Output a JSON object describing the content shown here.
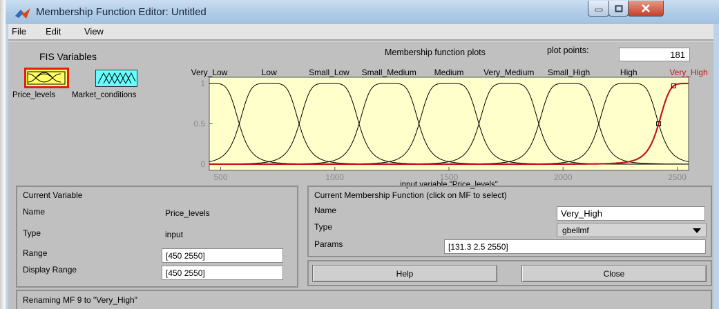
{
  "window": {
    "title": "Membership Function Editor: Untitled"
  },
  "menu": [
    "File",
    "Edit",
    "View"
  ],
  "fis": {
    "heading": "FIS Variables",
    "variables": [
      {
        "label": "Price_levels",
        "color": "#ffff66",
        "selected": true
      },
      {
        "label": "Market_conditions",
        "color": "#66ffff",
        "selected": false
      }
    ]
  },
  "plot": {
    "heading": "Membership function plots",
    "points_label": "plot points:",
    "points_value": "181",
    "xlabel": "input variable \"Price_levels\""
  },
  "chart_data": {
    "type": "line",
    "xlim": [
      450,
      2550
    ],
    "ylim": [
      0,
      1
    ],
    "xticks": [
      500,
      1000,
      1500,
      2000,
      2500
    ],
    "yticks": [
      0,
      0.5,
      1
    ],
    "xlabel": "input variable \"Price_levels\"",
    "series": [
      {
        "name": "Very_Low",
        "centers": [
          450
        ]
      },
      {
        "name": "Low",
        "centers": [
          712.5
        ]
      },
      {
        "name": "Small_Low",
        "centers": [
          975
        ]
      },
      {
        "name": "Small_Medium",
        "centers": [
          1237.5
        ]
      },
      {
        "name": "Medium",
        "centers": [
          1500
        ]
      },
      {
        "name": "Very_Medium",
        "centers": [
          1762.5
        ]
      },
      {
        "name": "Small_High",
        "centers": [
          2025
        ]
      },
      {
        "name": "High",
        "centers": [
          2287.5
        ]
      },
      {
        "name": "Very_High",
        "centers": [
          2550
        ],
        "params": [
          131.3,
          2.5,
          2550
        ],
        "selected": true,
        "color": "#c4161c"
      }
    ]
  },
  "current_variable": {
    "heading": "Current Variable",
    "name_label": "Name",
    "name_value": "Price_levels",
    "type_label": "Type",
    "type_value": "input",
    "range_label": "Range",
    "range_value": "[450 2550]",
    "display_range_label": "Display Range",
    "display_range_value": "[450 2550]"
  },
  "current_mf": {
    "heading": "Current Membership Function (click on MF to select)",
    "name_label": "Name",
    "name_value": "Very_High",
    "type_label": "Type",
    "type_value": "gbellmf",
    "params_label": "Params",
    "params_value": "[131.3 2.5 2550]"
  },
  "buttons": {
    "help": "Help",
    "close": "Close"
  },
  "status": "Renaming MF 9 to \"Very_High\""
}
